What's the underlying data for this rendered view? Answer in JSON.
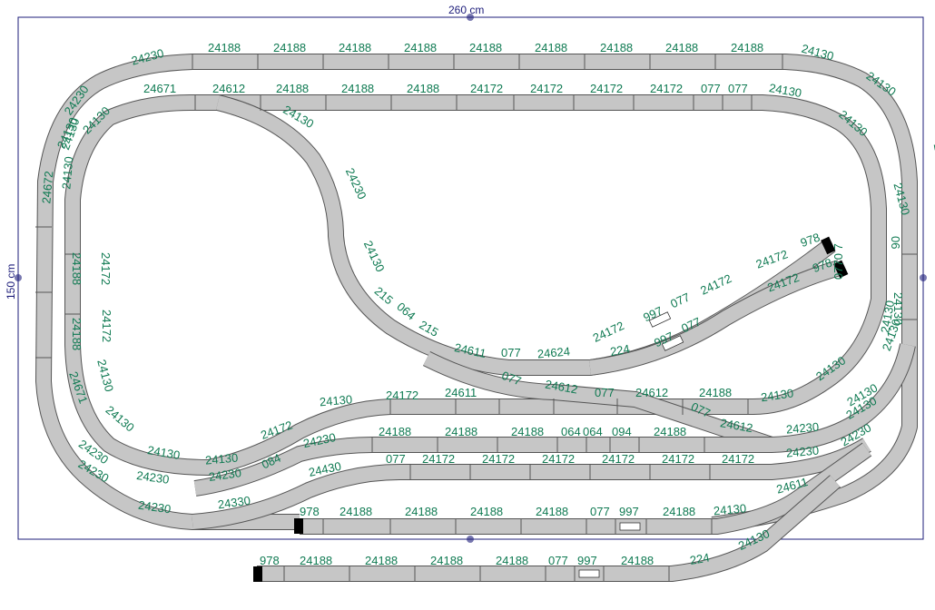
{
  "board": {
    "width_label": "260 cm",
    "height_label": "150 cm",
    "colors": {
      "outline": "#1c1c7a",
      "track_fill": "#c6c6c6",
      "track_edge": "#555555",
      "label": "#0f7a52",
      "buffer": "#000000"
    }
  },
  "labels": {
    "outer_top": [
      "24188",
      "24188",
      "24188",
      "24188",
      "24188",
      "24188",
      "24188",
      "24188",
      "24188"
    ],
    "outer_curves": [
      "24230",
      "24130",
      "24230",
      "24130",
      "24130",
      "24672",
      "24130",
      "24672",
      "24188",
      "24188",
      "24188",
      "24188",
      "24230",
      "24230",
      "24671",
      "24230"
    ],
    "inner_top": [
      "24671",
      "24612",
      "24188",
      "24188",
      "24188",
      "24172",
      "24172",
      "24172",
      "24172",
      "077",
      "077",
      "24130",
      "24130",
      "24130",
      "06",
      "0770 7"
    ],
    "inner_left": [
      "24130",
      "24130",
      "24130",
      "24172",
      "24172",
      "24130",
      "24130",
      "24130",
      "24130"
    ],
    "inner_loop": [
      "24130",
      "24230",
      "24130",
      "215",
      "064",
      "215",
      "24611",
      "077",
      "24624",
      "224",
      "24611",
      "077",
      "24612",
      "077",
      "24612",
      "24188",
      "24130",
      "24130",
      "24130",
      "24130",
      "077",
      "24612"
    ],
    "sidings": [
      "24172",
      "978",
      "24172",
      "978",
      "24172",
      "997",
      "077",
      "24172",
      "997",
      "077"
    ],
    "lower_rows": [
      "24172",
      "24130",
      "24172",
      "24230",
      "24188",
      "24188",
      "24188",
      "064",
      "064",
      "094",
      "24188",
      "24230",
      "24230",
      "084",
      "24230",
      "24430",
      "077",
      "24172",
      "24172",
      "24172",
      "24172",
      "24172",
      "24172",
      "24230",
      "24330",
      "24611",
      "24130",
      "24130",
      "24230"
    ],
    "yard1": [
      "978",
      "24188",
      "24188",
      "24188",
      "24188",
      "077",
      "997",
      "24188",
      "24130",
      "24130"
    ],
    "yard2": [
      "978",
      "24188",
      "24188",
      "24188",
      "24188",
      "077",
      "997",
      "24188",
      "224"
    ]
  }
}
